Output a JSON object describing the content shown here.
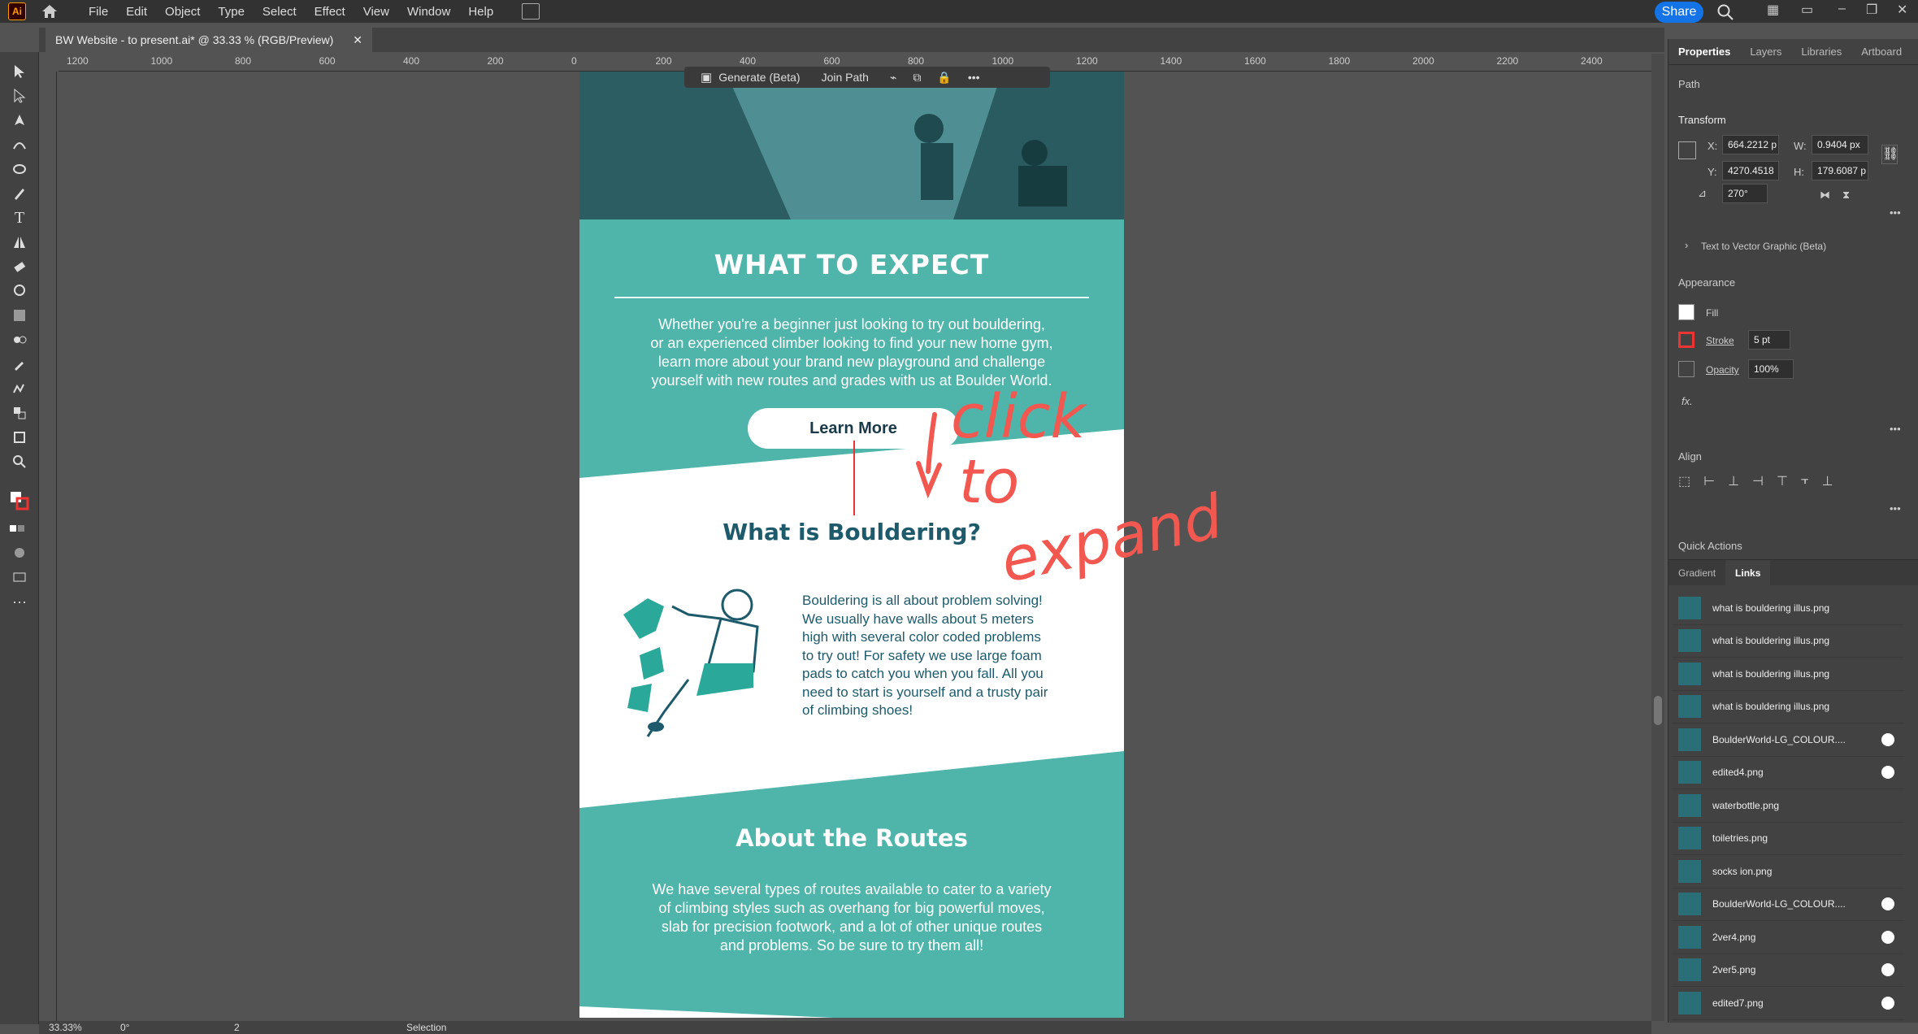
{
  "app": {
    "logo": "Ai"
  },
  "menu": [
    "File",
    "Edit",
    "Object",
    "Type",
    "Select",
    "Effect",
    "View",
    "Window",
    "Help"
  ],
  "share_label": "Share",
  "document_tab": "BW Website - to present.ai* @ 33.33 % (RGB/Preview)",
  "ruler_top": [
    "1200",
    "1000",
    "800",
    "600",
    "400",
    "200",
    "0",
    "200",
    "400",
    "600",
    "800",
    "1000",
    "1200",
    "1400",
    "1600",
    "1800",
    "2000",
    "2200",
    "2400"
  ],
  "context_bar": {
    "generate": "Generate (Beta)",
    "join": "Join Path"
  },
  "artboard": {
    "what_title": "WHAT TO EXPECT",
    "what_body": [
      "Whether you're a beginner just looking to try out bouldering,",
      "or an experienced climber looking to find your new home gym,",
      "learn more about your brand new playground and challenge",
      "yourself with new routes and grades with us at Boulder World."
    ],
    "learn_more": "Learn More",
    "bouldering_title": "What is Bouldering?",
    "bouldering_body": [
      "Bouldering is all about problem solving!",
      "We usually have walls about 5 meters",
      "high with several color coded problems",
      "to try out! For safety we use large foam",
      "pads to catch you when you fall. All you",
      "need to start is yourself and a trusty pair",
      "of climbing shoes!"
    ],
    "routes_title": "About the Routes",
    "routes_body": [
      "We have several types of routes available to cater to a variety",
      "of climbing styles such as overhang for big powerful moves,",
      "slab for precision footwork, and a lot of other unique routes",
      "and problems. So be sure to try them all!"
    ]
  },
  "annotation": {
    "line1": "click",
    "line2": "to",
    "line3": "expand"
  },
  "panel": {
    "tabs": [
      "Properties",
      "Layers",
      "Libraries",
      "Artboard"
    ],
    "path": "Path",
    "transform": "Transform",
    "x_label": "X:",
    "x": "664.2212 p",
    "y_label": "Y:",
    "y": "4270.4518",
    "w_label": "W:",
    "w": "0.9404 px",
    "h_label": "H:",
    "h": "179.6087 p",
    "angle": "270°",
    "text_to_vector": "Text to Vector Graphic (Beta)",
    "appearance": "Appearance",
    "fill": "Fill",
    "stroke": "Stroke",
    "stroke_value": "5 pt",
    "opacity": "Opacity",
    "opacity_value": "100%",
    "fx": "fx.",
    "align": "Align",
    "quick_actions": "Quick Actions",
    "links_tabs": [
      "Gradient",
      "Links"
    ]
  },
  "links": [
    "what is bouldering illus.png",
    "what is bouldering illus.png",
    "what is bouldering illus.png",
    "what is bouldering illus.png",
    "BoulderWorld-LG_COLOUR....",
    "edited4.png",
    "waterbottle.png",
    "toiletries.png",
    "socks ion.png",
    "BoulderWorld-LG_COLOUR....",
    "2ver4.png",
    "2ver5.png",
    "edited7.png"
  ],
  "status": {
    "zoom": "33.33%",
    "rotate": "0°",
    "page": "2",
    "tool": "Selection"
  }
}
